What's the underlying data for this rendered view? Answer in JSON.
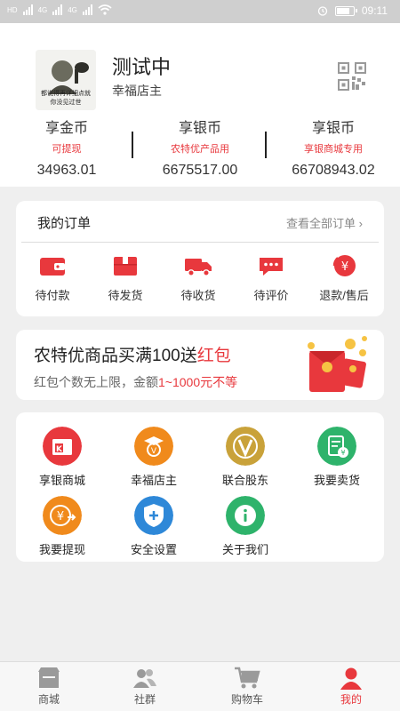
{
  "status_bar": {
    "net_labels": [
      "HD",
      "4G",
      "4G"
    ],
    "time": "09:11",
    "battery_level": 0.85
  },
  "profile": {
    "username": "测试中",
    "role": "幸福店主",
    "avatar_text_1": "都说得再详细点就",
    "avatar_text_2": "你没见过世"
  },
  "coins": [
    {
      "title": "享金币",
      "subtitle": "可提现",
      "value": "34963.01"
    },
    {
      "title": "享银币",
      "subtitle": "农特优产品用",
      "value": "6675517.00"
    },
    {
      "title": "享银币",
      "subtitle": "享银商城专用",
      "value": "66708943.02"
    }
  ],
  "orders": {
    "title": "我的订单",
    "view_all": "查看全部订单 ›",
    "items": [
      {
        "label": "待付款",
        "icon": "wallet-icon"
      },
      {
        "label": "待发货",
        "icon": "package-icon"
      },
      {
        "label": "待收货",
        "icon": "truck-icon"
      },
      {
        "label": "待评价",
        "icon": "comment-icon"
      },
      {
        "label": "退款/售后",
        "icon": "refund-icon"
      }
    ]
  },
  "promo": {
    "title_main": "农特优商品买满100送",
    "title_red": "红包",
    "sub_main": "红包个数无上限，金额",
    "sub_red": "1~1000元不等"
  },
  "menu": {
    "items": [
      {
        "label": "享银商城",
        "icon": "store-icon",
        "color": "#e8383d"
      },
      {
        "label": "幸福店主",
        "icon": "shopkeeper-icon",
        "color": "#f08a1c"
      },
      {
        "label": "联合股东",
        "icon": "v-badge-icon",
        "color": "#c9a23a"
      },
      {
        "label": "我要卖货",
        "icon": "sell-icon",
        "color": "#2eb36b"
      },
      {
        "label": "我要提现",
        "icon": "withdraw-icon",
        "color": "#f08a1c"
      },
      {
        "label": "安全设置",
        "icon": "shield-icon",
        "color": "#2e88d8"
      },
      {
        "label": "关于我们",
        "icon": "info-icon",
        "color": "#2eb36b"
      }
    ]
  },
  "tabbar": {
    "items": [
      {
        "label": "商城",
        "icon": "shop-icon",
        "active": false
      },
      {
        "label": "社群",
        "icon": "community-icon",
        "active": false
      },
      {
        "label": "购物车",
        "icon": "cart-icon",
        "active": false
      },
      {
        "label": "我的",
        "icon": "profile-icon",
        "active": true
      }
    ]
  },
  "colors": {
    "accent": "#e8383d",
    "background": "#efefef"
  }
}
